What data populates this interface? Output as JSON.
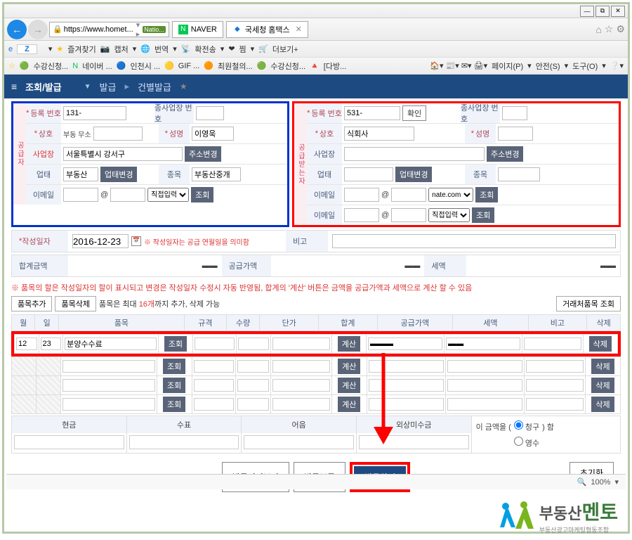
{
  "window": {
    "url_display": "https://www.homet...",
    "url_suffix": "Natio...",
    "tabs": [
      {
        "favicon_color": "#00c853",
        "label": "NAVER",
        "closeable": false
      },
      {
        "favicon_color": "#1976d2",
        "label": "국세청 홈택스",
        "closeable": true
      }
    ],
    "home_icon": "⌂",
    "star_icon": "☆",
    "gear_icon": "⚙"
  },
  "toolbar2": {
    "items": [
      "즐겨찾기",
      "캡처",
      "번역",
      "확전송",
      "찜",
      "더보기+"
    ],
    "left_icons": [
      "IE",
      "Z"
    ]
  },
  "toolbar3": {
    "items": [
      "수강신청...",
      "네이버 ...",
      "인천시 ...",
      "GIF ...",
      "최원철의...",
      "수강신청...",
      "[다방..."
    ],
    "right_items": [
      "페이지(P)",
      "안전(S)",
      "도구(O)"
    ]
  },
  "nav": {
    "hamburger": "≡",
    "title": "조회/발급",
    "crumbs": [
      "발급",
      "건별발급"
    ]
  },
  "supplier": {
    "heading": "공급자",
    "rows": {
      "reg_no": {
        "label": "등록\n번호",
        "value": "131-",
        "sub_label": "종사업장\n번호"
      },
      "company": {
        "label": "상호",
        "prefix": "부동\n무소",
        "name_label": "성명",
        "name_value": "이영욱"
      },
      "address": {
        "label": "사업장",
        "value": "서울특별시 강서구",
        "btn": "주소변경"
      },
      "biztype": {
        "label": "업태",
        "value": "부동산",
        "btn": "업태변경",
        "item_label": "종목",
        "item_value": "부동산중개"
      },
      "email": {
        "label": "이메일",
        "btn": "조회",
        "direct": "직접입력"
      }
    }
  },
  "buyer": {
    "heading": "공급받는자",
    "rows": {
      "reg_no": {
        "label": "등록\n번호",
        "value": "531-",
        "confirm_btn": "확인",
        "sub_label": "종사업장\n번호"
      },
      "company": {
        "label": "상호",
        "value": "식회사",
        "name_label": "성명"
      },
      "address": {
        "label": "사업장",
        "btn": "주소변경"
      },
      "biztype": {
        "label": "업태",
        "btn": "업태변경",
        "item_label": "종목"
      },
      "email1": {
        "label": "이메일",
        "domain": "nate.com",
        "btn": "조회"
      },
      "email2": {
        "label": "이메일",
        "direct": "직접입력",
        "btn": "조회"
      }
    }
  },
  "write_date": {
    "label": "작성일자",
    "value": "2016-12-23",
    "note": "※ 작성일자는 공급 연월일을 의미함",
    "remark_label": "비고"
  },
  "totals": {
    "total_label": "합계금액",
    "supply_label": "공급가액",
    "tax_label": "세액"
  },
  "items_hint": "※ 품목의 할은 작성일자의 할이 표시되고 변경은 작성일자 수정시 자동 반영됨, 합계의 '계산' 버튼은 금액을 공급가액과 세액으로 계산 할 수 있음",
  "item_btns": {
    "add": "품목추가",
    "delete": "품목삭제"
  },
  "item_note_prefix": "품목은 최대 ",
  "item_note_count": "16개",
  "item_note_suffix": "까지 추가, 삭제 가능",
  "vendor_lookup_btn": "거래처품목 조회",
  "items_header": [
    "월",
    "일",
    "품목",
    "규격",
    "수량",
    "단가",
    "합계",
    "공급가액",
    "세액",
    "비고",
    "삭제"
  ],
  "items_rows": [
    {
      "month": "12",
      "day": "23",
      "name": "분양수수료",
      "lookup": "조회",
      "calc": "계산",
      "del": "삭제"
    },
    {
      "lookup": "조회",
      "calc": "계산",
      "del": "삭제"
    },
    {
      "lookup": "조회",
      "calc": "계산",
      "del": "삭제"
    },
    {
      "lookup": "조회",
      "calc": "계산",
      "del": "삭제"
    }
  ],
  "payment": {
    "cash": "현금",
    "check": "수표",
    "note": "어음",
    "credit": "외상미수금",
    "radio_text_prefix": "이 금액을 (",
    "radio_opt1": "청구",
    "radio_opt2": "영수",
    "radio_text_suffix": ") 함"
  },
  "bottom": {
    "preview": "발급미리보기",
    "hold": "발급보류",
    "issue": "발급하기",
    "reset": "초기화"
  },
  "status": {
    "zoom": "100%"
  },
  "footer": {
    "brand1": "부동산",
    "brand2": "멘토",
    "sub": "부동산광고마케팅협동조합"
  }
}
